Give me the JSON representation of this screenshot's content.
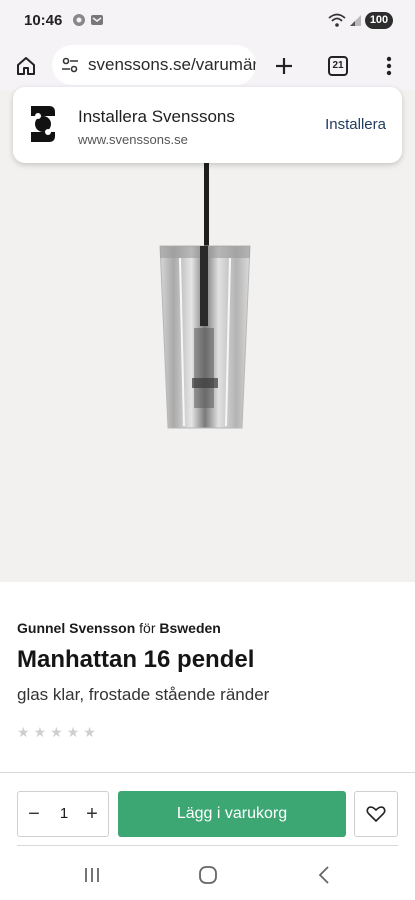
{
  "status_bar": {
    "time": "10:46",
    "battery": "100"
  },
  "browser": {
    "url": "svenssons.se/varumärken",
    "tab_count": "21"
  },
  "install_banner": {
    "title": "Installera Svenssons",
    "url": "www.svenssons.se",
    "action": "Installera"
  },
  "product": {
    "designer": "Gunnel Svensson",
    "connector": "för",
    "brand": "Bsweden",
    "name": "Manhattan 16 pendel",
    "variant": "glas klar, frostade stående ränder",
    "rating_stars": 5,
    "rating_value": 0
  },
  "purchase": {
    "quantity": "1",
    "minus_label": "−",
    "plus_label": "+",
    "add_to_cart_label": "Lägg i varukorg"
  },
  "colors": {
    "accent": "#3da774",
    "hero_bg": "#f2f1ef",
    "chrome_bg": "#f5f3f6"
  }
}
